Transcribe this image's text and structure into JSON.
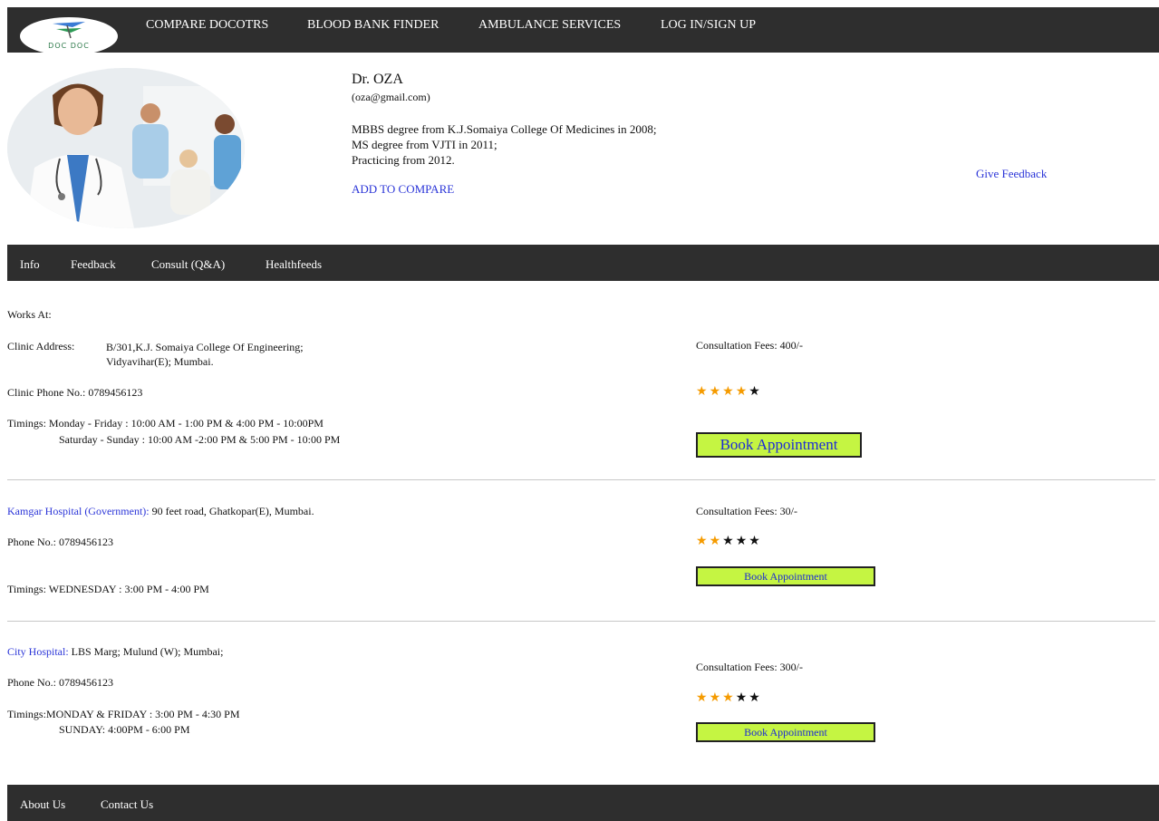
{
  "nav": {
    "logo_text": "DOC DOC",
    "items": [
      "COMPARE DOCOTRS",
      "BLOOD BANK FINDER",
      "AMBULANCE SERVICES",
      "LOG IN/SIGN UP"
    ]
  },
  "doctor": {
    "name": "Dr. OZA",
    "email": "(oza@gmail.com)",
    "qualifications": [
      "MBBS degree from K.J.Somaiya College Of Medicines in 2008;",
      "MS degree from VJTI in 2011;",
      "Practicing from 2012."
    ],
    "add_to_compare": "ADD TO COMPARE",
    "give_feedback": "Give Feedback"
  },
  "tabs": [
    "Info",
    "Feedback",
    "Consult (Q&A)",
    "Healthfeeds"
  ],
  "works_at": "Works At:",
  "clinic": {
    "address_label": "Clinic Address:",
    "address_line1": "B/301,K.J. Somaiya College Of Engineering;",
    "address_line2": "Vidyavihar(E); Mumbai.",
    "phone": "Clinic Phone No.: 0789456123",
    "timings_line1": "Timings: Monday - Friday : 10:00 AM - 1:00 PM & 4:00 PM - 10:00PM",
    "timings_line2": "Saturday - Sunday : 10:00 AM -2:00 PM & 5:00 PM - 10:00 PM",
    "fees": "Consultation Fees: 400/-",
    "rating": 4,
    "book_label": "Book Appointment"
  },
  "hospital1": {
    "name": "Kamgar Hospital (Government):",
    "address": "90 feet road, Ghatkopar(E), Mumbai.",
    "phone": "Phone No.: 0789456123",
    "timings": "Timings: WEDNESDAY : 3:00 PM - 4:00 PM",
    "fees": "Consultation Fees: 30/-",
    "rating": 2,
    "book_label": "Book Appointment"
  },
  "hospital2": {
    "name": "City Hospital:",
    "address": "LBS Marg; Mulund (W);  Mumbai;",
    "phone": "Phone No.: 0789456123",
    "timings_line1": "Timings:MONDAY & FRIDAY : 3:00 PM - 4:30 PM",
    "timings_line2": "SUNDAY: 4:00PM - 6:00 PM",
    "fees": "Consultation Fees: 300/-",
    "rating": 3,
    "book_label": "Book Appointment"
  },
  "footer": [
    "About Us",
    "Contact Us"
  ],
  "colors": {
    "accent": "#c5f542",
    "bar": "#2e2e2e",
    "link": "#2b35d8",
    "star": "#f59b00"
  }
}
